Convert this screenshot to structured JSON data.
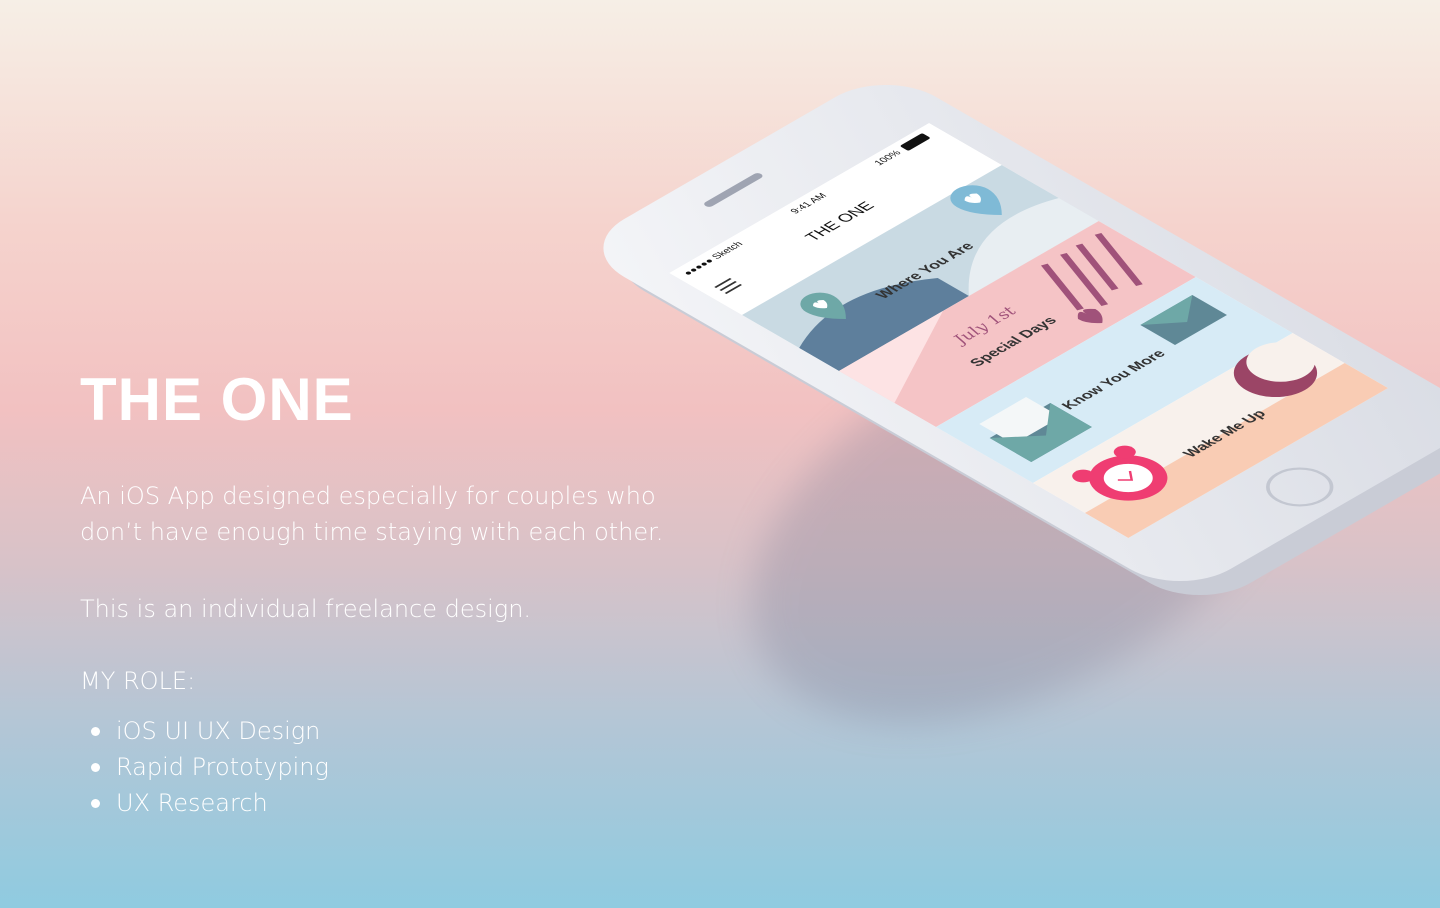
{
  "intro": {
    "title": "THE ONE",
    "description": "An iOS App designed especially for couples who don’t have enough time staying with each other.",
    "note": "This is an individual freelance design.",
    "role_heading": "MY ROLE:",
    "roles": [
      "iOS UI UX Design",
      "Rapid Prototyping",
      "UX Research"
    ]
  },
  "phone": {
    "status_bar": {
      "carrier": "●●●●● Sketch",
      "time": "9:41 AM",
      "battery": "100%"
    },
    "app_title": "THE ONE",
    "cards": [
      {
        "label": "Where You Are",
        "color": "#c9dae3"
      },
      {
        "label": "Special Days",
        "script": "July 1st",
        "color": "#f5c4c6"
      },
      {
        "label": "Know You More",
        "color": "#d7ebf6"
      },
      {
        "label": "Wake Me Up",
        "color": "#f8f1ec"
      }
    ]
  },
  "colors": {
    "accent_pink": "#ef3d72",
    "plum": "#9b4566",
    "slate": "#5f7f9a",
    "teal": "#6ea8a7"
  }
}
